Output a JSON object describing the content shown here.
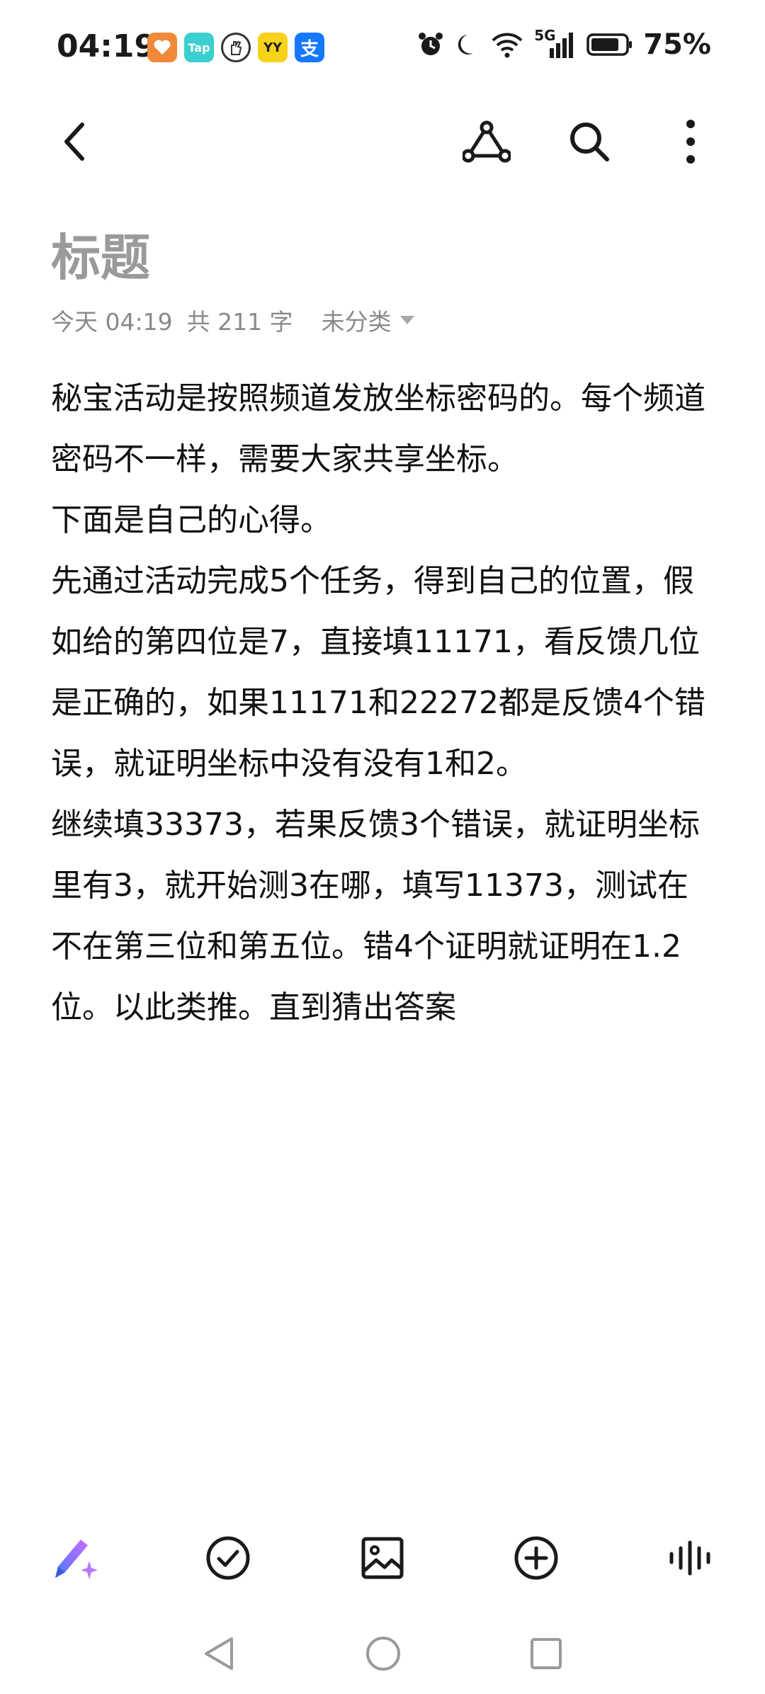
{
  "status_bar": {
    "time": "04:19",
    "app_icons": [
      {
        "name": "health-app-icon",
        "label": ""
      },
      {
        "name": "taptap-app-icon",
        "label": "Tap"
      },
      {
        "name": "hand-app-icon",
        "label": ""
      },
      {
        "name": "yy-app-icon",
        "label": "YY"
      },
      {
        "name": "alipay-app-icon",
        "label": "支"
      }
    ],
    "network_label": "5G",
    "battery": "75%"
  },
  "note": {
    "title": "标题",
    "date": "今天 04:19",
    "word_count": "共 211 字",
    "category": "未分类",
    "paragraphs": [
      "秘宝活动是按照频道发放坐标密码的。每个频道密码不一样，需要大家共享坐标。",
      "下面是自己的心得。",
      "先通过活动完成5个任务，得到自己的位置，假如给的第四位是7，直接填11171，看反馈几位是正确的，如果11171和22272都是反馈4个错误，就证明坐标中没有没有1和2。",
      "继续填33373，若果反馈3个错误，就证明坐标里有3，就开始测3在哪，填写11373，测试在不在第三位和第五位。错4个证明就证明在1.2位。以此类推。直到猜出答案"
    ]
  },
  "icons": {
    "toolbar": [
      "back-icon",
      "share-icon",
      "search-icon",
      "more-icon"
    ],
    "bottom": [
      "ai-pen-icon",
      "checklist-icon",
      "image-icon",
      "add-icon",
      "voice-icon"
    ],
    "nav": [
      "nav-back-icon",
      "nav-home-icon",
      "nav-recent-icon"
    ]
  },
  "colors": {
    "title": "#9a9a9a",
    "meta": "#8a8a8a",
    "body": "#111111",
    "ai_gradient_start": "#4a7bff",
    "ai_gradient_end": "#c86bff"
  }
}
